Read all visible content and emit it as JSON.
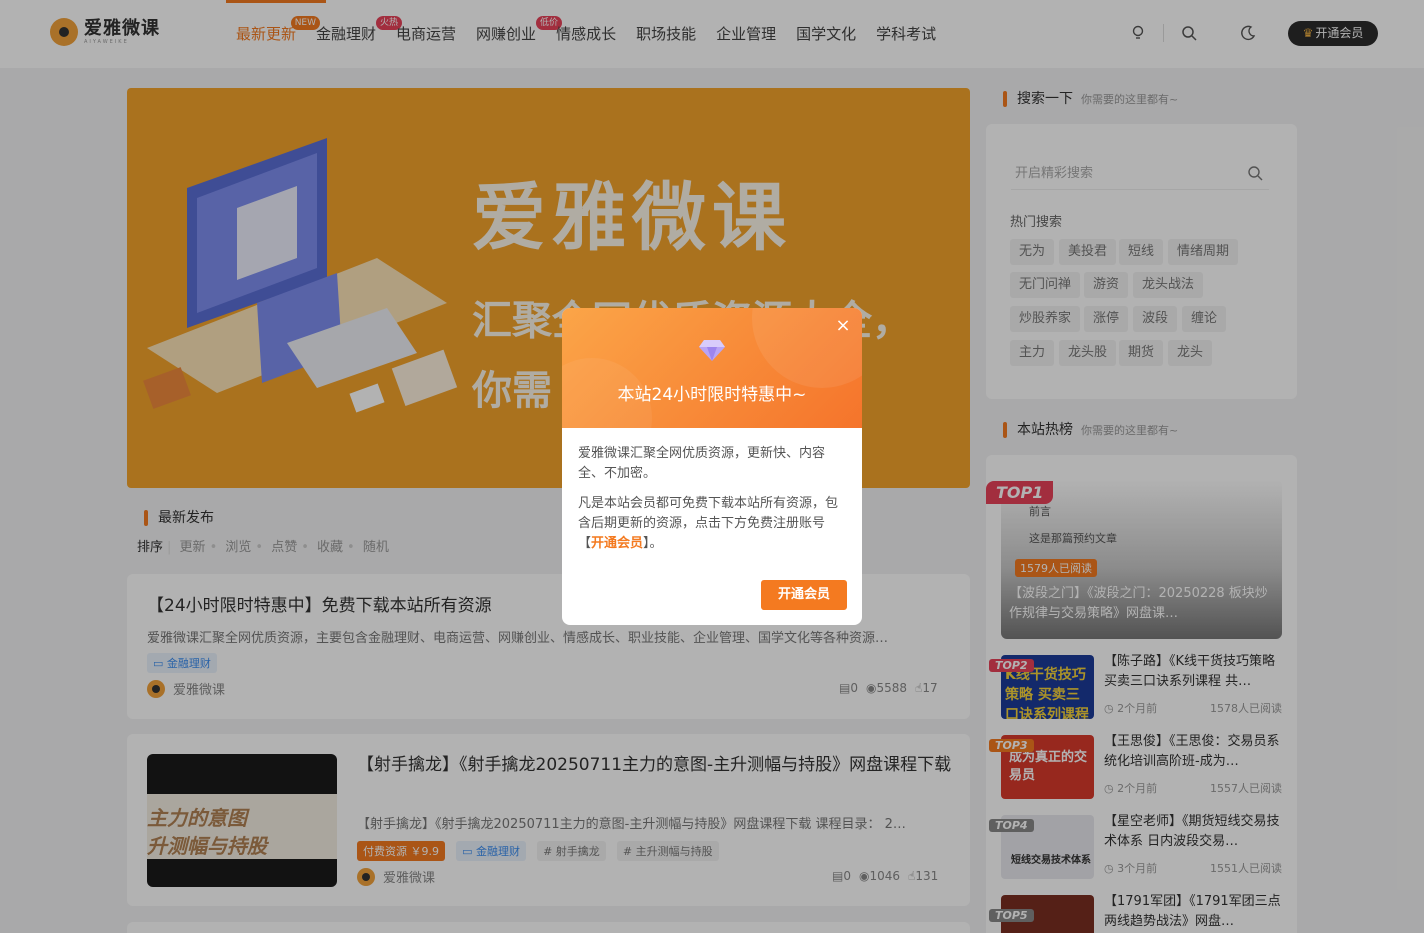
{
  "header": {
    "logo_name": "爱雅微课",
    "logo_sub": "AIYAWEIKE",
    "nav": [
      {
        "label": "最新更新",
        "badge": "NEW",
        "badge_color": "#f47a20"
      },
      {
        "label": "金融理财",
        "badge": "火热",
        "badge_color": "#e8425a"
      },
      {
        "label": "电商运营"
      },
      {
        "label": "网赚创业",
        "badge": "低价",
        "badge_color": "#e8425a"
      },
      {
        "label": "情感成长"
      },
      {
        "label": "职场技能"
      },
      {
        "label": "企业管理"
      },
      {
        "label": "国学文化"
      },
      {
        "label": "学科考试"
      }
    ],
    "vip_label": "开通会员"
  },
  "banner": {
    "title": "爱雅微课",
    "line1": "汇聚全网优质资源大全，",
    "line2": "你需"
  },
  "latest": {
    "title": "最新发布",
    "sort_label": "排序",
    "sort_options": [
      "更新",
      "浏览",
      "点赞",
      "收藏",
      "随机"
    ]
  },
  "posts": [
    {
      "title": "【24小时限时特惠中】免费下载本站所有资源",
      "desc": "爱雅微课汇聚全网优质资源，主要包含金融理财、电商运营、网赚创业、情感成长、职业技能、企业管理、国学文化等各种资源…",
      "tags": [
        "金融理财"
      ],
      "author": "爱雅微课",
      "comments": "0",
      "views": "5588",
      "likes": "17"
    },
    {
      "title": "【射手擒龙】《射手擒龙20250711主力的意图-主升测幅与持股》网盘课程下载",
      "desc": "【射手擒龙】《射手擒龙20250711主力的意图-主升测幅与持股》网盘课程下载   课程目录：  2…",
      "price_tag": "付费资源 ￥9.9",
      "category_tag": "金融理财",
      "tags": [
        "# 射手擒龙",
        "# 主升测幅与持股"
      ],
      "thumb_text_1": "主力的意图",
      "thumb_text_2": "升测幅与持股",
      "author": "爱雅微课",
      "comments": "0",
      "views": "1046",
      "likes": "131"
    }
  ],
  "sidebar": {
    "search": {
      "title": "搜索一下",
      "subtitle": "你需要的这里都有~",
      "placeholder": "开启精彩搜索"
    },
    "hot_search_label": "热门搜索",
    "keywords": [
      "无为",
      "美投君",
      "短线",
      "情绪周期",
      "无门问禅",
      "游资",
      "龙头战法",
      "炒股养家",
      "涨停",
      "波段",
      "缠论",
      "主力",
      "龙头股",
      "期货",
      "龙头"
    ],
    "hot": {
      "title": "本站热榜",
      "subtitle": "你需要的这里都有~"
    },
    "top1": {
      "badge": "TOP1",
      "preface": "前言",
      "notice": "这是那篇预约文章",
      "reads": "1579人已阅读",
      "title": "【波段之门】《波段之门：20250228 板块炒作规律与交易策略》网盘课…"
    },
    "ranks": [
      {
        "badge": "TOP2",
        "title": "【陈子路】《K线干货技巧策略买卖三口诀系列课程 共…",
        "time": "2个月前",
        "reads": "1578人已阅读",
        "thumb": "K线干货技巧策略 买卖三口诀系列课程"
      },
      {
        "badge": "TOP3",
        "title": "【王思俊】《王思俊：交易员系统化培训高阶班-成为…",
        "time": "2个月前",
        "reads": "1557人已阅读",
        "thumb": "成为真正的交易员"
      },
      {
        "badge": "TOP4",
        "title": "【星空老师】《期货短线交易技术体系 日内波段交易…",
        "time": "3个月前",
        "reads": "1551人已阅读",
        "thumb": "短线交易技术体系"
      },
      {
        "badge": "TOP5",
        "title": "【1791军团】《1791军团三点两线趋势战法》网盘…",
        "time": "",
        "reads": "",
        "thumb": ""
      }
    ]
  },
  "modal": {
    "title": "本站24小时限时特惠中~",
    "p1": "爱雅微课汇聚全网优质资源，更新快、内容全、不加密。",
    "p2_before": "凡是本站会员都可免费下载本站所有资源，包含后期更新的资源，点击下方免费注册账号【",
    "p2_highlight": "开通会员",
    "p2_after": "】。",
    "button": "开通会员",
    "close": "×"
  }
}
